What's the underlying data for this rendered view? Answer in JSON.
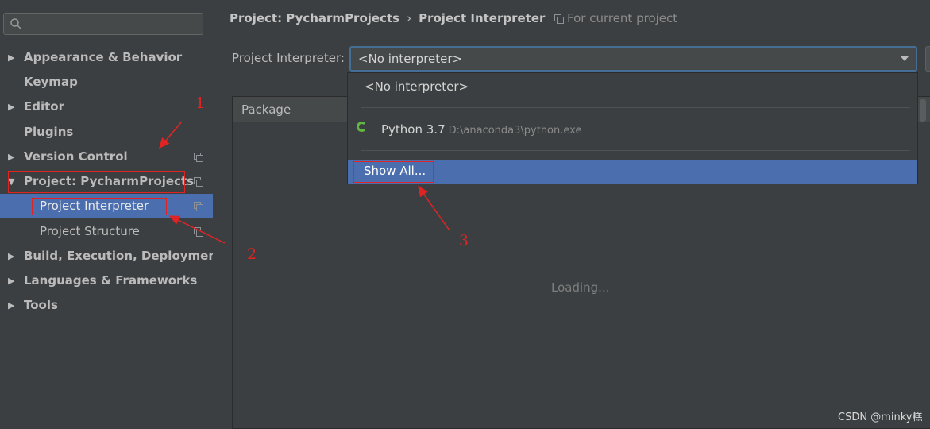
{
  "sidebar": {
    "search_placeholder": "",
    "items": [
      {
        "label": "Appearance & Behavior",
        "arrow": "▶"
      },
      {
        "label": "Keymap",
        "arrow": ""
      },
      {
        "label": "Editor",
        "arrow": "▶"
      },
      {
        "label": "Plugins",
        "arrow": ""
      },
      {
        "label": "Version Control",
        "arrow": "▶"
      },
      {
        "label": "Project: PycharmProjects",
        "arrow": "▼"
      },
      {
        "label": "Project Interpreter",
        "arrow": "",
        "selected": true
      },
      {
        "label": "Project Structure",
        "arrow": ""
      },
      {
        "label": "Build, Execution, Deployment",
        "arrow": "▶"
      },
      {
        "label": "Languages & Frameworks",
        "arrow": "▶"
      },
      {
        "label": "Tools",
        "arrow": "▶"
      }
    ]
  },
  "header": {
    "breadcrumb_parent": "Project: PycharmProjects",
    "breadcrumb_separator": "›",
    "breadcrumb_current": "Project Interpreter",
    "for_current": "For current project"
  },
  "interpreter": {
    "label": "Project Interpreter:",
    "value": "<No interpreter>"
  },
  "dropdown": {
    "none_option": "<No interpreter>",
    "python_name": "Python 3.7",
    "python_path": "D:\\anaconda3\\python.exe",
    "show_all": "Show All..."
  },
  "packages": {
    "column_package": "Package",
    "loading": "Loading..."
  },
  "annotations": {
    "n1": "1",
    "n2": "2",
    "n3": "3"
  },
  "watermark": "CSDN @minky糕",
  "colors": {
    "background": "#3c3f41",
    "selection": "#4b6eaf",
    "annotation": "#e02424",
    "spinner": "#62b543"
  }
}
